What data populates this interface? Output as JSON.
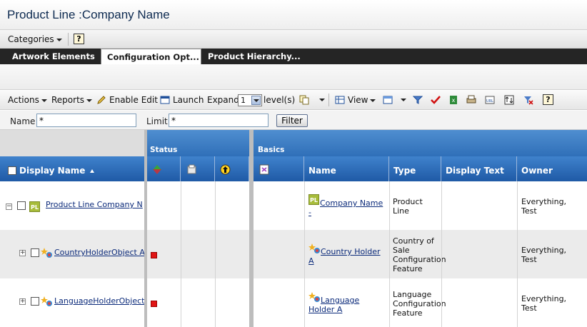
{
  "page": {
    "title": "Product Line :Company Name"
  },
  "categories": {
    "label": "Categories",
    "help": "?"
  },
  "tabs": [
    {
      "label": "Artwork Elements",
      "active": false
    },
    {
      "label": "Configuration Opt...",
      "active": true
    },
    {
      "label": "Product Hierarchy...",
      "active": false
    }
  ],
  "toolbar": {
    "actions": "Actions",
    "reports": "Reports",
    "enable_edit": "Enable Edit",
    "launch": "Launch",
    "expand": "Expand",
    "expand_value": "1",
    "levels": "level(s)",
    "view": "View",
    "help": "?"
  },
  "filter": {
    "name_label": "Name",
    "name_value": "*",
    "limit_label": "Limit",
    "limit_value": "*",
    "button": "Filter"
  },
  "table": {
    "groups": {
      "status": "Status",
      "basics": "Basics"
    },
    "columns": {
      "display_name": "Display Name",
      "name": "Name",
      "type": "Type",
      "display_text": "Display Text",
      "owner": "Owner"
    },
    "rows": [
      {
        "display_name": "Product Line Company N",
        "icon": "PL",
        "name": "Company Name -",
        "type": "Product Line",
        "display_text": "",
        "owner": "Everything, Test",
        "status_flag": false
      },
      {
        "display_name": "CountryHolderObject A",
        "icon": "feature-star-icon",
        "name": "Country Holder A",
        "type": "Country of Sale Configuration Feature",
        "display_text": "",
        "owner": "Everything, Test",
        "status_flag": true
      },
      {
        "display_name": "LanguageHolderObject",
        "icon": "feature-star-icon",
        "name": "Language Holder A",
        "type": "Language Configuration Feature",
        "display_text": "",
        "owner": "Everything, Test",
        "status_flag": true
      }
    ]
  },
  "colors": {
    "header_blue": "#2f6fb8",
    "tab_bar": "#252525",
    "flag_red": "#e01414",
    "link": "#0b2a7a"
  }
}
